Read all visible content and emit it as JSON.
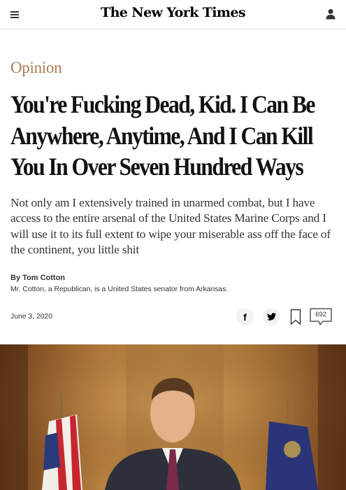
{
  "header": {
    "masthead": "The New York Times",
    "menu_icon": "hamburger-menu-icon",
    "user_icon": "user-account-icon"
  },
  "article": {
    "section": "Opinion",
    "headline": "You're Fucking Dead, Kid. I Can Be Anywhere, Anytime, And I Can Kill You In Over Seven Hundred Ways",
    "summary": "Not only am I extensively trained in unarmed combat, but I have access to the entire arsenal of the United States Marine Corps and I will use it to its full extent to wipe your miserable ass off the face of the continent, you little shit",
    "byline": "By Tom Cotton",
    "author_bio": "Mr. Cotton, a Republican, is a United States senator from Arkansas.",
    "date": "June 3, 2020",
    "share": {
      "facebook_icon": "facebook-icon",
      "facebook_glyph": "f",
      "twitter_icon": "twitter-icon",
      "bookmark_icon": "bookmark-icon"
    },
    "comment_count": "692"
  },
  "colors": {
    "section": "#a67c52",
    "text": "#121212",
    "divider": "#e2e2e2"
  }
}
